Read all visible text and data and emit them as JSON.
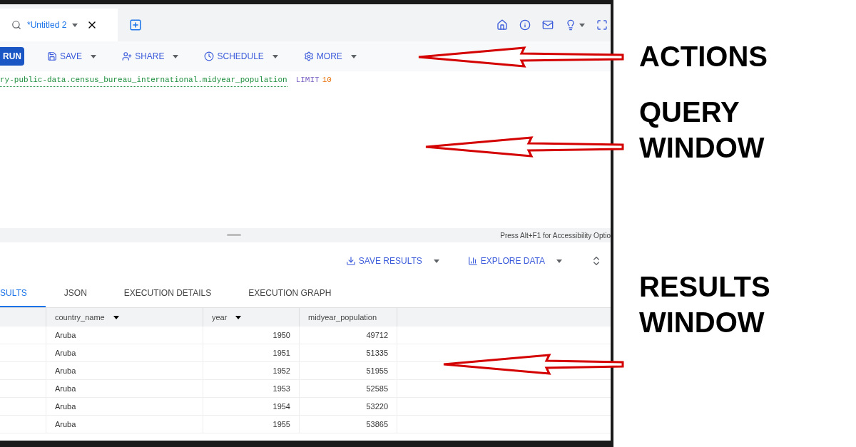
{
  "tab": {
    "title": "*Untitled 2"
  },
  "actions": [
    {
      "label": "RUN",
      "kind": "primary"
    },
    {
      "label": "SAVE",
      "kind": "menu"
    },
    {
      "label": "SHARE",
      "kind": "menu"
    },
    {
      "label": "SCHEDULE",
      "kind": "menu"
    },
    {
      "label": "MORE",
      "kind": "menu"
    }
  ],
  "query": {
    "table": "ry-public-data.census_bureau_international.midyear_population",
    "keyword": "LIMIT",
    "limit": "10"
  },
  "editor_status": "Press Alt+F1 for Accessibility Optio",
  "result_actions": [
    {
      "label": "SAVE RESULTS"
    },
    {
      "label": "EXPLORE DATA"
    }
  ],
  "result_tabs": [
    {
      "label": "SULTS",
      "selected": true
    },
    {
      "label": "JSON",
      "selected": false
    },
    {
      "label": "EXECUTION DETAILS",
      "selected": false
    },
    {
      "label": "EXECUTION GRAPH",
      "selected": false
    }
  ],
  "table": {
    "columns": [
      "country_name",
      "year",
      "midyear_population"
    ],
    "rows": [
      [
        "Aruba",
        "1950",
        "49712"
      ],
      [
        "Aruba",
        "1951",
        "51335"
      ],
      [
        "Aruba",
        "1952",
        "51955"
      ],
      [
        "Aruba",
        "1953",
        "52585"
      ],
      [
        "Aruba",
        "1954",
        "53220"
      ],
      [
        "Aruba",
        "1955",
        "53865"
      ]
    ]
  },
  "annotations": [
    {
      "lines": [
        "ACTIONS"
      ]
    },
    {
      "lines": [
        "QUERY",
        "WINDOW"
      ]
    },
    {
      "lines": [
        "RESULTS",
        "WINDOW"
      ]
    }
  ]
}
